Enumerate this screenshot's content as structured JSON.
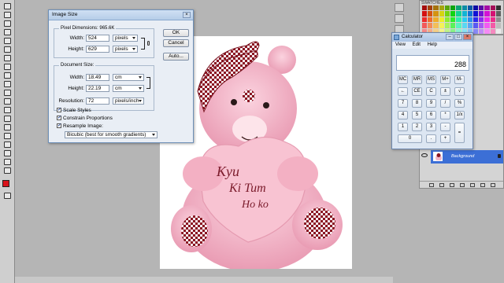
{
  "image_size_dialog": {
    "title": "Image Size",
    "pixel_dimensions": {
      "legend": "Pixel Dimensions:",
      "size": "965.6K",
      "width_label": "Width:",
      "width_value": "524",
      "width_unit": "pixels",
      "height_label": "Height:",
      "height_value": "629",
      "height_unit": "pixels"
    },
    "document_size": {
      "legend": "Document Size:",
      "width_label": "Width:",
      "width_value": "18.49",
      "width_unit": "cm",
      "height_label": "Height:",
      "height_value": "22.19",
      "height_unit": "cm",
      "resolution_label": "Resolution:",
      "resolution_value": "72",
      "resolution_unit": "pixels/inch"
    },
    "scale_styles": "Scale Styles",
    "constrain_proportions": "Constrain Proportions",
    "resample_image": "Resample Image:",
    "resample_method": "Bicubic (best for smooth gradients)",
    "ok_label": "OK",
    "cancel_label": "Cancel",
    "auto_label": "Auto..."
  },
  "calculator": {
    "title": "Calculator",
    "menu": [
      "View",
      "Edit",
      "Help"
    ],
    "display": "288",
    "keys": [
      [
        "MC",
        "MR",
        "MS",
        "M+",
        "M-"
      ],
      [
        "←",
        "CE",
        "C",
        "±",
        "√"
      ],
      [
        "7",
        "8",
        "9",
        "/",
        "%"
      ],
      [
        "4",
        "5",
        "6",
        "*",
        "1/x"
      ],
      [
        "1",
        "2",
        "3",
        "-",
        "="
      ],
      [
        "0",
        ".",
        "+"
      ]
    ]
  },
  "swatches_tab": "SWATCHES",
  "layer_name": "Background",
  "canvas_photo": {
    "text": [
      "Kyu",
      "Ki Tum",
      "Ho ko"
    ]
  },
  "colors": {
    "accent": "#3c6fd6",
    "foreground": "#d8121a",
    "bear_pink": "#f2b6c9"
  }
}
